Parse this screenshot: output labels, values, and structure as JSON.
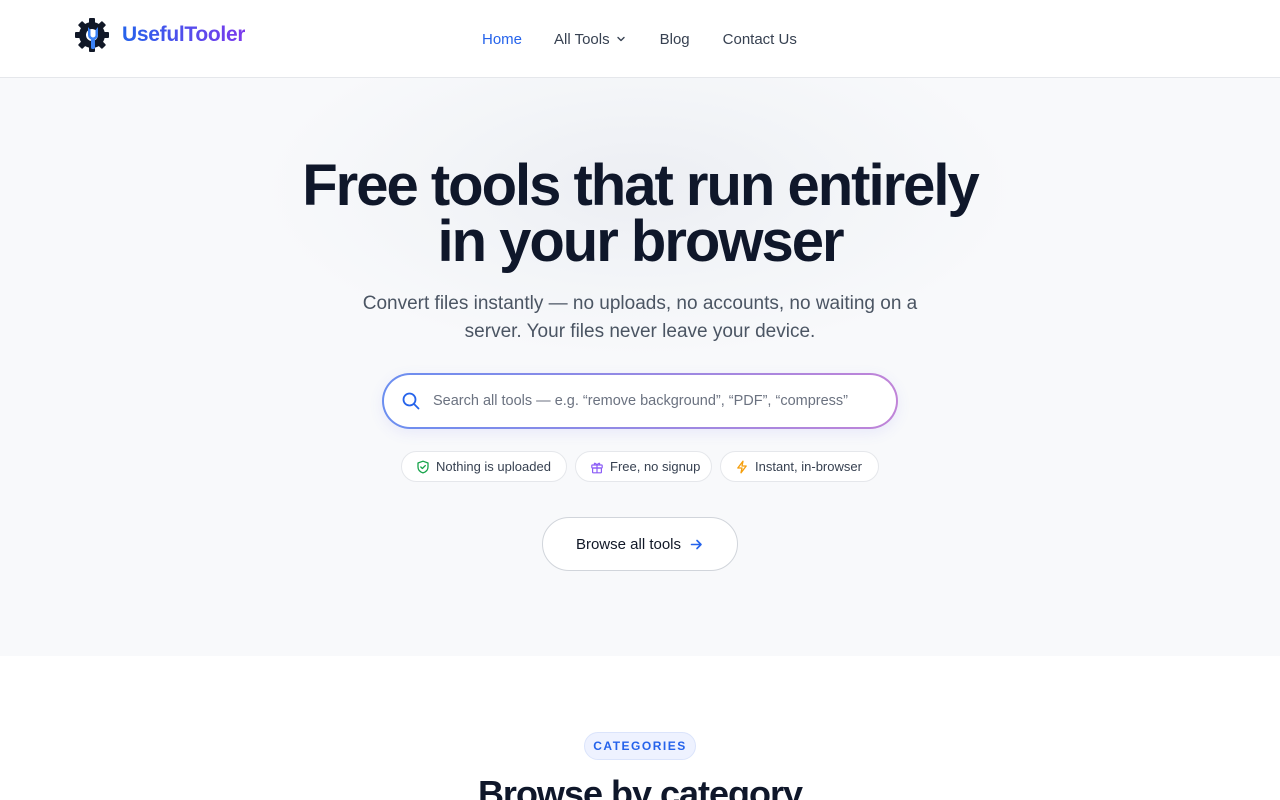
{
  "brand": {
    "name": "UsefulTooler",
    "logo_icon": "gear-wrench-icon"
  },
  "nav": {
    "home": "Home",
    "all_tools": "All Tools",
    "blog": "Blog",
    "contact": "Contact Us"
  },
  "hero": {
    "title_line1": "Free tools that run entirely",
    "title_line2": "in your browser",
    "subtitle_line1": "Convert files instantly — no uploads, no accounts, no waiting on a",
    "subtitle_line2": "server. Your files never leave your device."
  },
  "search": {
    "placeholder": "Search all tools — e.g. “remove background”, “PDF”, “compress”",
    "value": ""
  },
  "badges": [
    {
      "label": "Nothing is uploaded",
      "icon": "shield-check-icon"
    },
    {
      "label": "Free, no signup",
      "icon": "gift-icon"
    },
    {
      "label": "Instant, in-browser",
      "icon": "lightning-icon"
    }
  ],
  "browse_button": {
    "label": "Browse all tools",
    "icon": "arrow-right-icon"
  },
  "categories": {
    "label": "CATEGORIES",
    "title": "Browse by category"
  },
  "colors": {
    "accent": "#2563eb",
    "brand_gradient_start": "#2563eb",
    "brand_gradient_end": "#7c3aed",
    "heading": "#0f172a",
    "shield_green": "#16a34a",
    "gift_purple": "#8b5cf6",
    "lightning_amber": "#f59e0b"
  }
}
